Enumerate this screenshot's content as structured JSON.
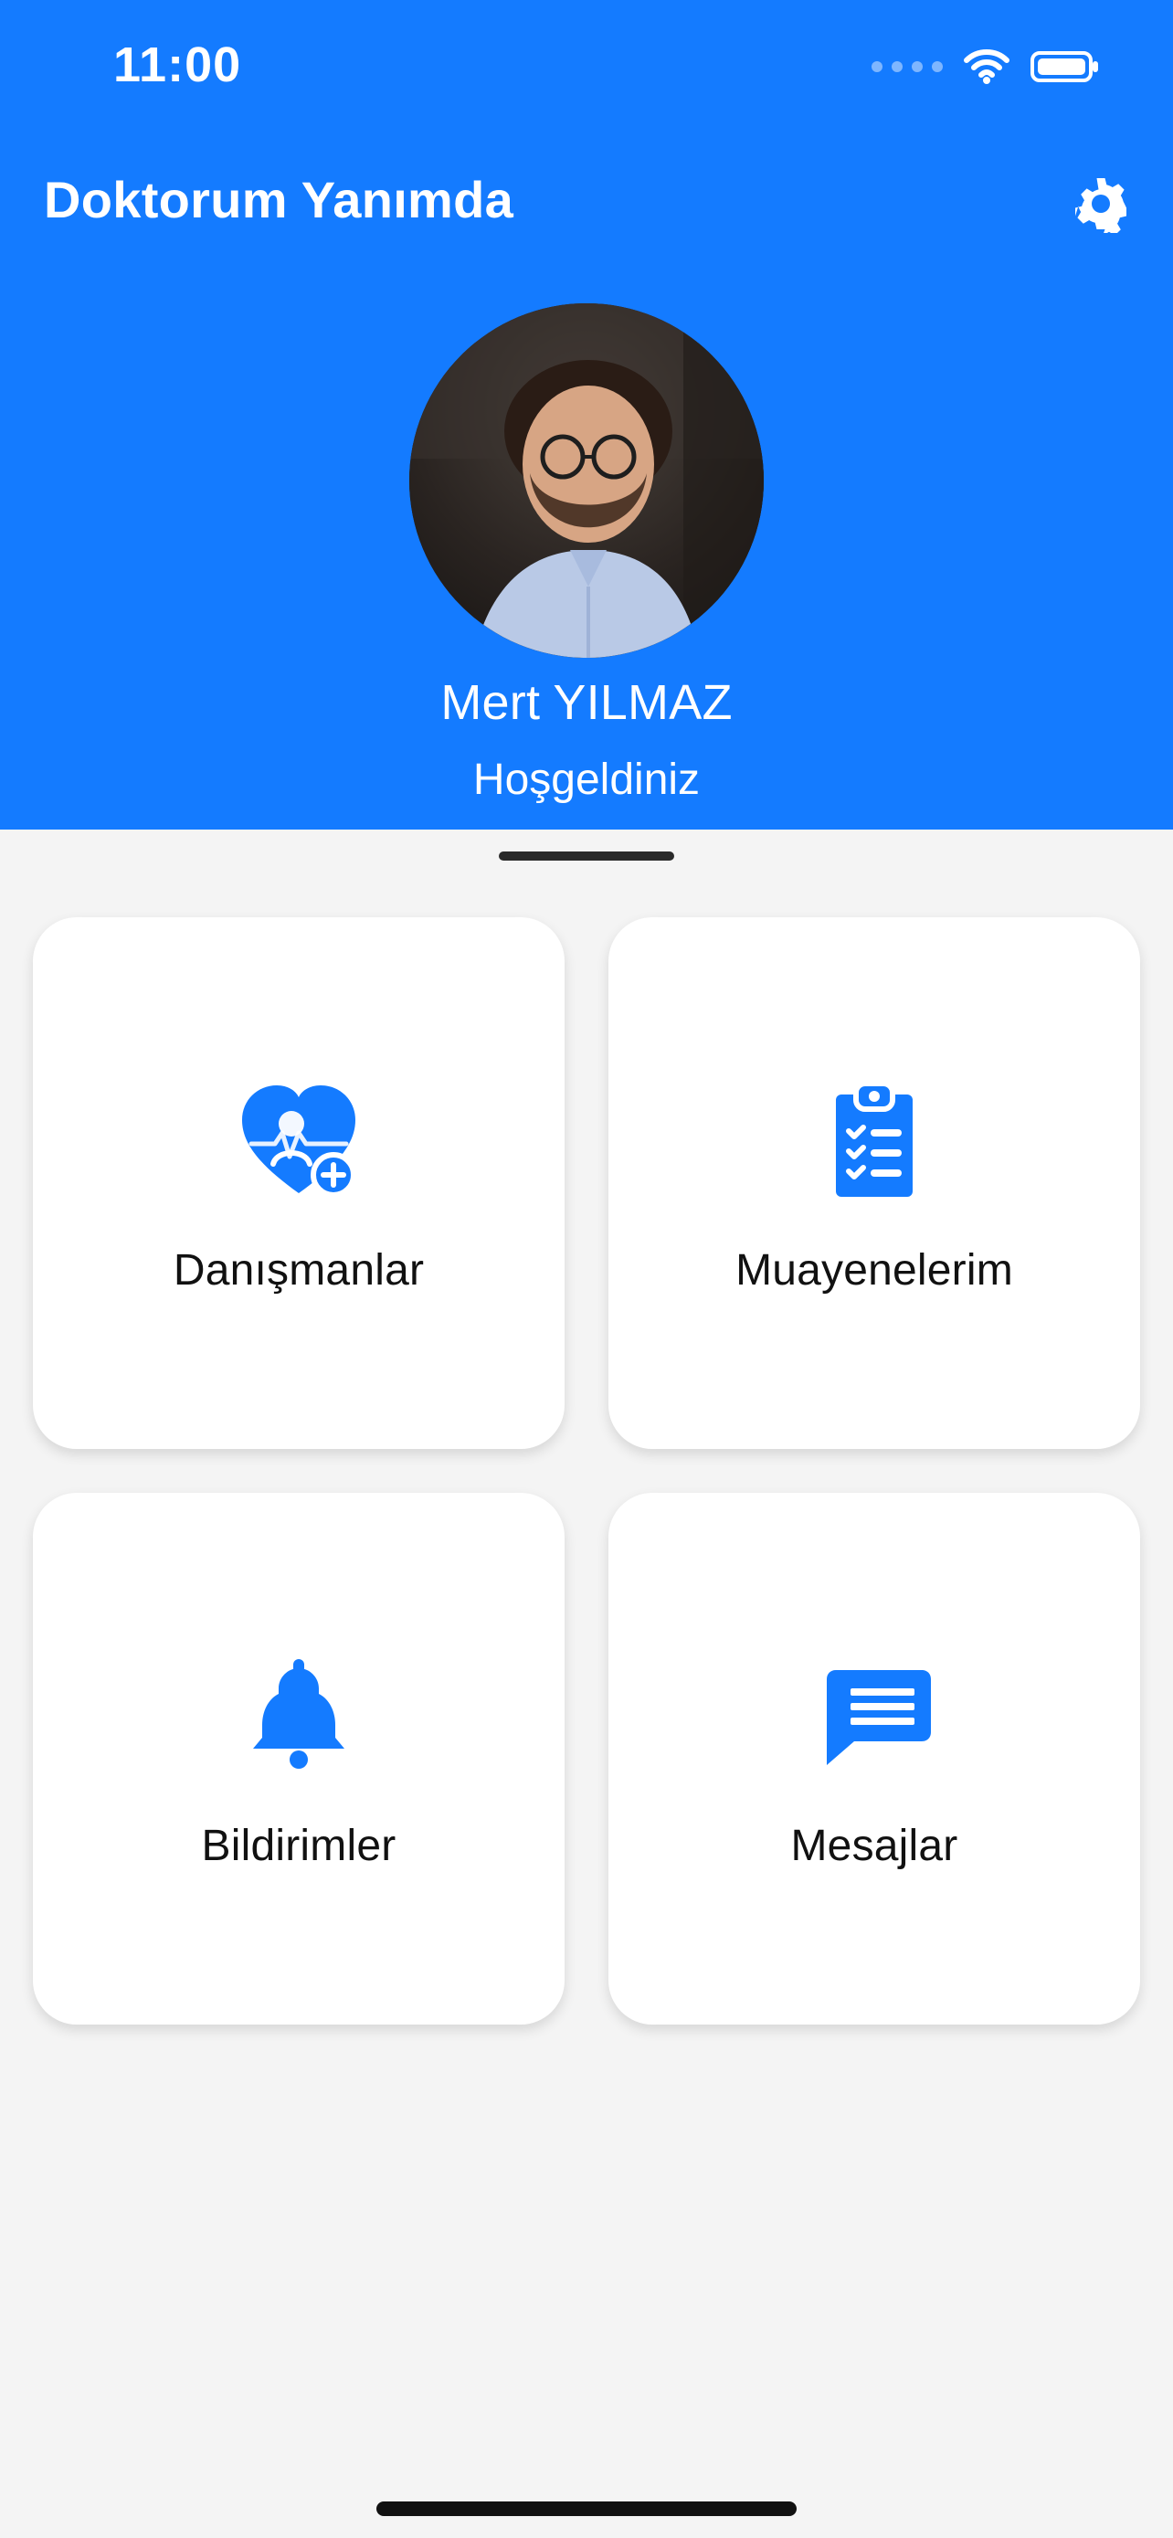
{
  "status_bar": {
    "time": "11:00"
  },
  "header": {
    "app_title": "Doktorum Yanımda",
    "settings_icon": "gear-icon",
    "user": {
      "name": "Mert YILMAZ",
      "greeting": "Hoşgeldiniz"
    }
  },
  "menu": [
    {
      "label": "Danışmanlar",
      "icon": "doctor-heart-plus-icon"
    },
    {
      "label": "Muayenelerim",
      "icon": "clipboard-checklist-icon"
    },
    {
      "label": "Bildirimler",
      "icon": "bell-icon"
    },
    {
      "label": "Mesajlar",
      "icon": "message-icon"
    }
  ],
  "colors": {
    "primary": "#147BFF",
    "background": "#F4F4F4",
    "card": "#FFFFFF",
    "text": "#111111"
  }
}
